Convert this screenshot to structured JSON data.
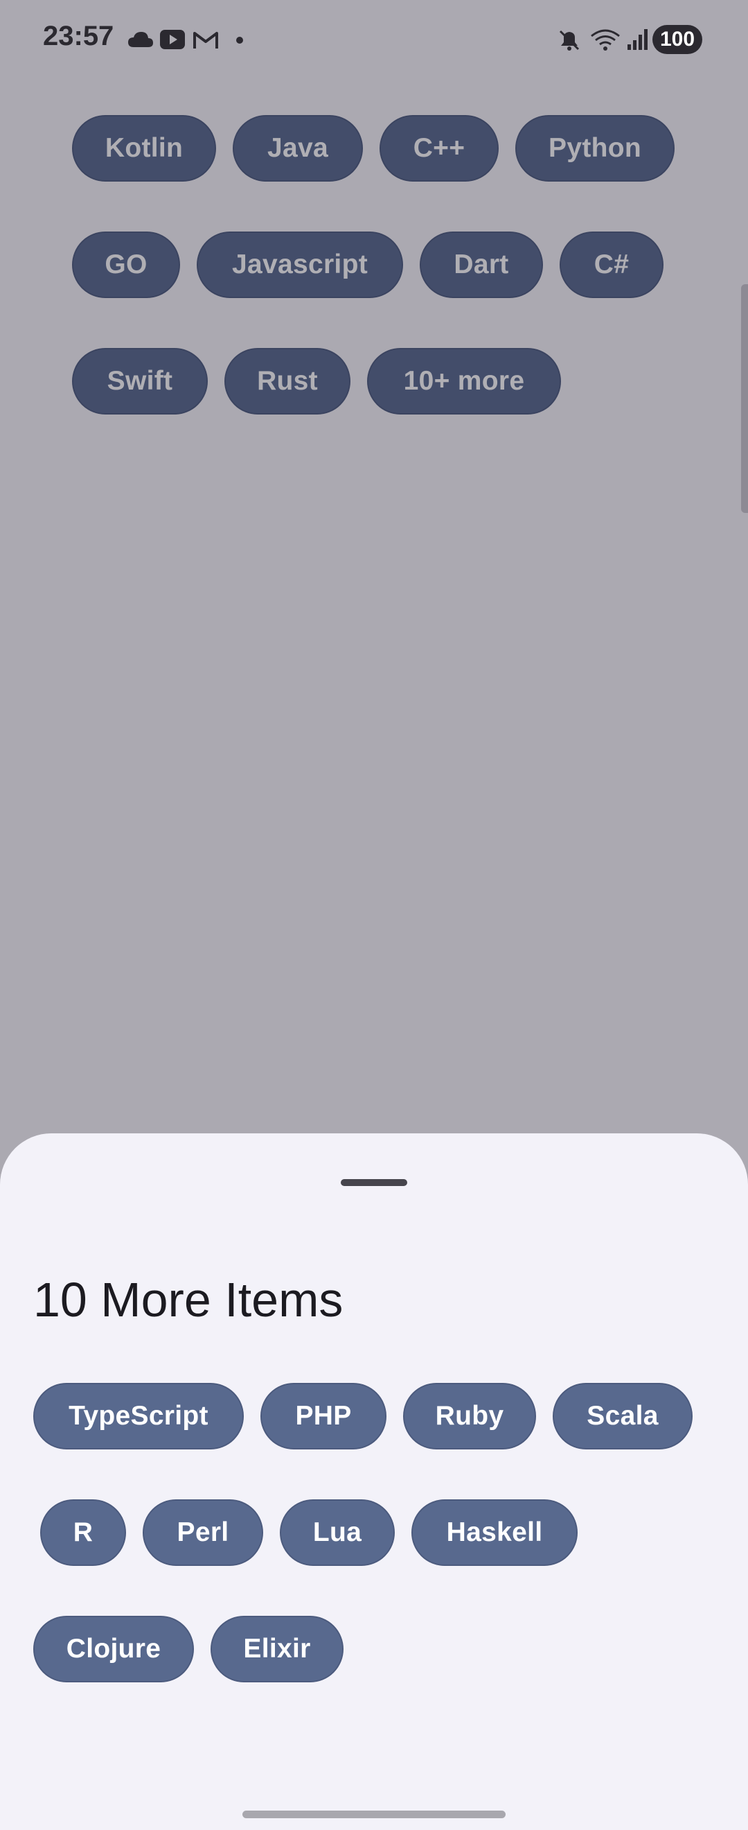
{
  "status_bar": {
    "time": "23:57",
    "battery": "100",
    "left_icons": [
      "cloud-icon",
      "youtube-icon",
      "gmail-icon",
      "dot-icon"
    ],
    "right_icons": [
      "mute-icon",
      "wifi-icon",
      "signal-icon"
    ]
  },
  "chips": {
    "row1": [
      "Kotlin",
      "Java",
      "C++",
      "Python"
    ],
    "row2": [
      "GO",
      "Javascript",
      "Dart",
      "C#"
    ],
    "row3": [
      "Swift",
      "Rust",
      "10+ more"
    ]
  },
  "sheet": {
    "title": "10 More Items",
    "row1": [
      "TypeScript",
      "PHP",
      "Ruby",
      "Scala"
    ],
    "row2": [
      "R",
      "Perl",
      "Lua",
      "Haskell"
    ],
    "row3": [
      "Clojure",
      "Elixir"
    ]
  },
  "colors": {
    "chip_bg": "#58698e",
    "scrim": "rgba(30,25,40,0.35)",
    "sheet_bg": "#f3f2f9"
  }
}
